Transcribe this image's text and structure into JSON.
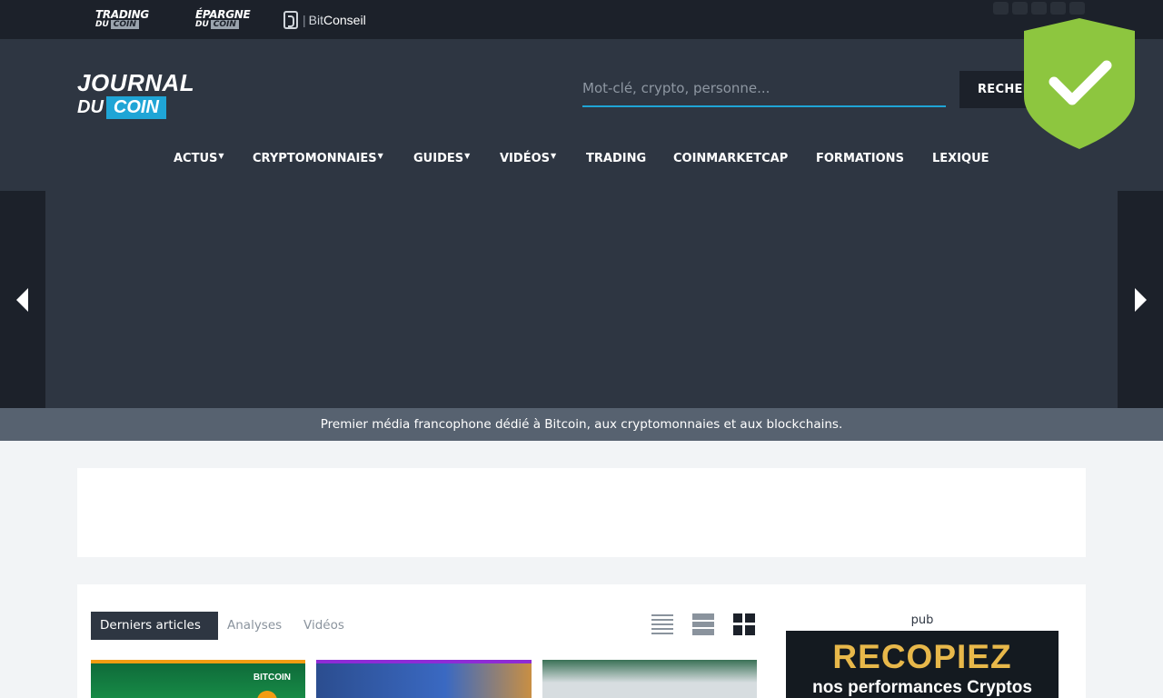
{
  "topbar": {
    "brands": [
      {
        "name": "TRADING",
        "sub_du": "DU",
        "sub_coin": "COIN"
      },
      {
        "name": "ÉPARGNE",
        "sub_du": "DU",
        "sub_coin": "COIN"
      }
    ],
    "bitconseil": {
      "bit": "Bit",
      "conseil": "Conseil"
    },
    "social_icons": [
      "youtube-icon",
      "twitter-icon",
      "facebook-icon",
      "linkedin-icon",
      "instagram-icon"
    ]
  },
  "header": {
    "logo_line1": "JOURNAL",
    "logo_du": "DU",
    "logo_coin": "COIN",
    "search_placeholder": "Mot-clé, crypto, personne...",
    "search_button": "RECHERCHER",
    "nav": [
      {
        "label": "ACTUS",
        "dropdown": true
      },
      {
        "label": "CRYPTOMONNAIES",
        "dropdown": true
      },
      {
        "label": "GUIDES",
        "dropdown": true
      },
      {
        "label": "VIDÉOS",
        "dropdown": true
      },
      {
        "label": "TRADING",
        "dropdown": false
      },
      {
        "label": "COINMARKETCAP",
        "dropdown": false
      },
      {
        "label": "FORMATIONS",
        "dropdown": false
      },
      {
        "label": "LEXIQUE",
        "dropdown": false
      }
    ]
  },
  "tagline": "Premier média francophone dédié à Bitcoin, aux cryptomonnaies et aux blockchains.",
  "content": {
    "tabs": [
      "Derniers articles",
      "Analyses",
      "Vidéos"
    ],
    "cards": [
      {
        "label": "BITCOIN"
      },
      {
        "label": ""
      },
      {
        "label": ""
      }
    ],
    "pub_label": "pub",
    "pub_banner_big": "RECOPIEZ",
    "pub_banner_small": "nos performances Cryptos"
  },
  "colors": {
    "topbar": "#1c212a",
    "header": "#2e3642",
    "accent": "#1fa5d6",
    "tagline_bg": "#576270",
    "shield": "#8dc63f"
  }
}
